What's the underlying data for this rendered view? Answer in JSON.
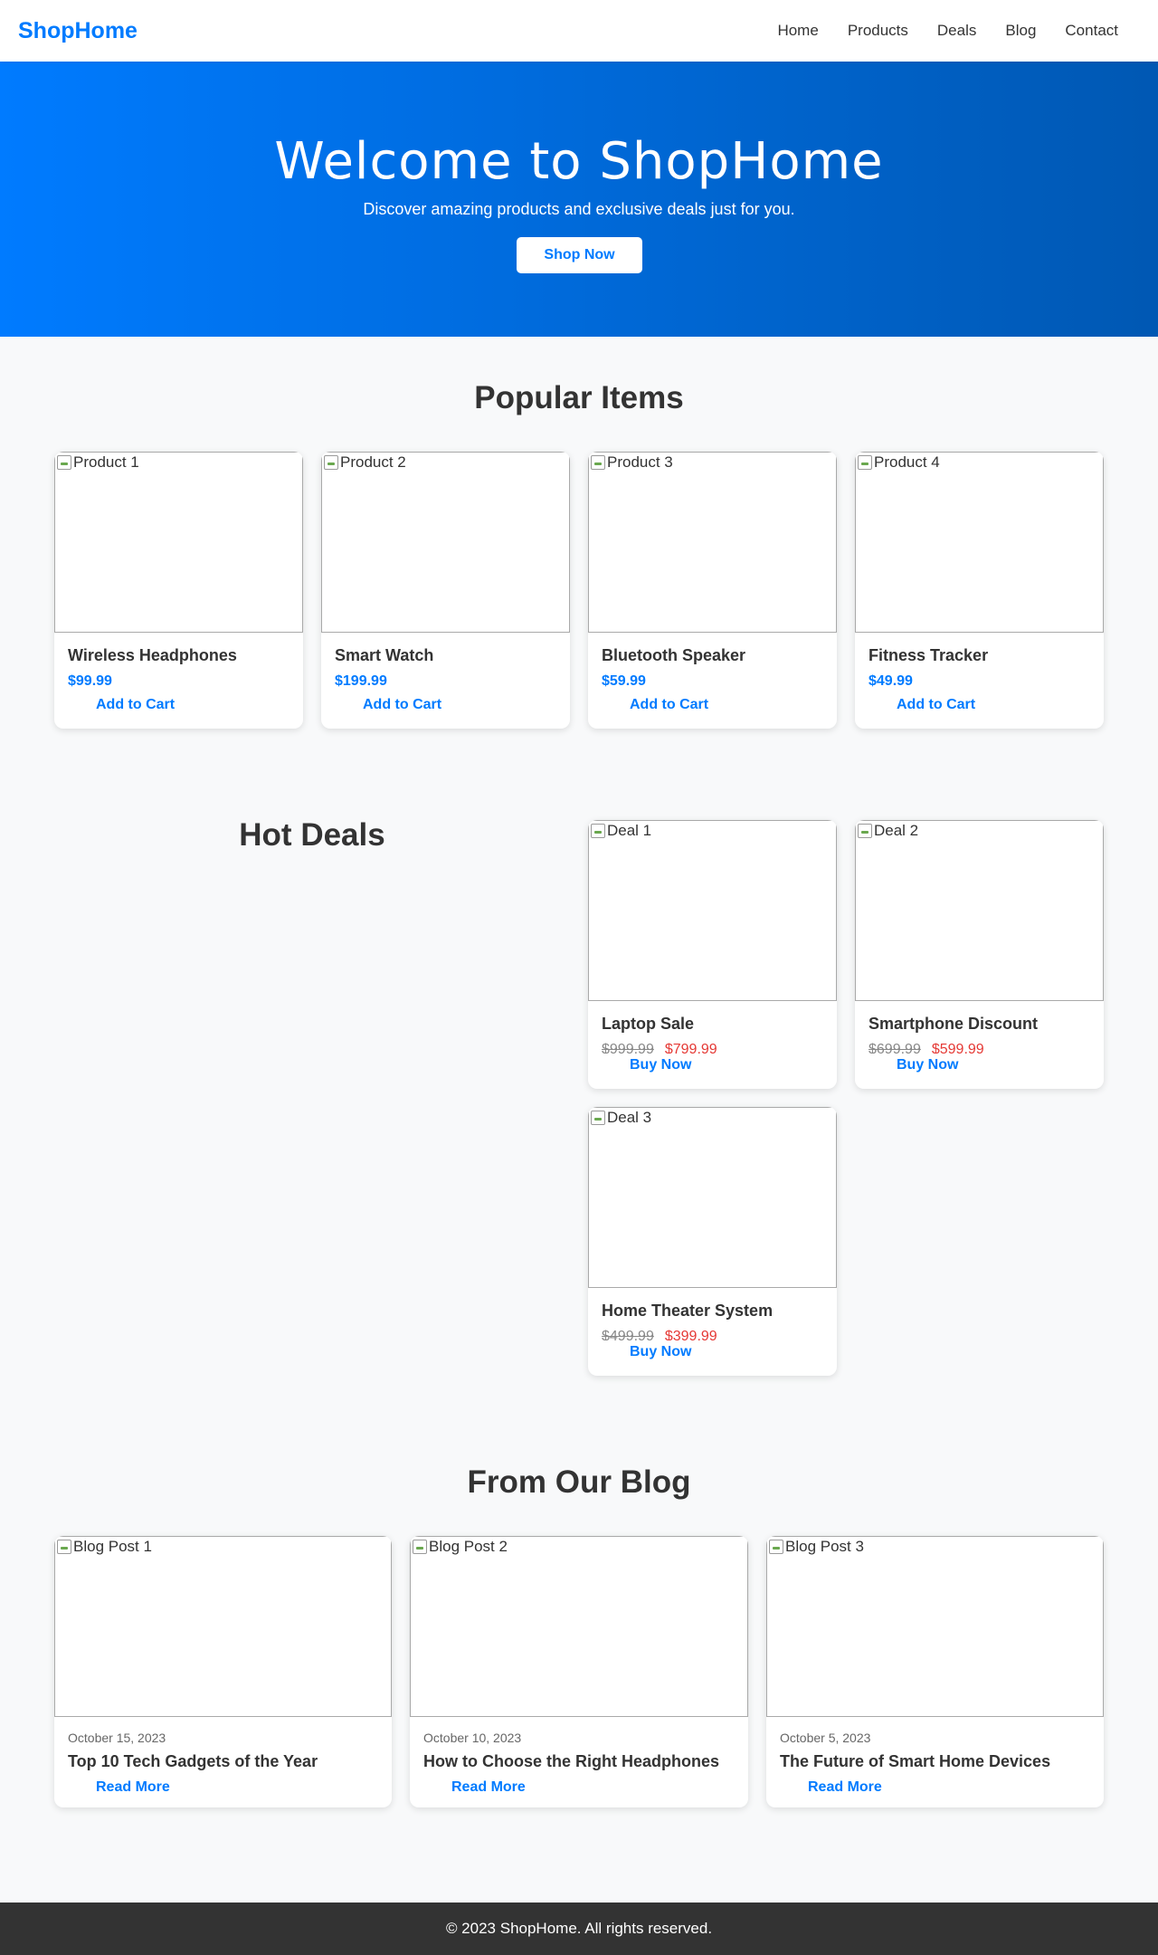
{
  "header": {
    "logo": "ShopHome",
    "nav": [
      "Home",
      "Products",
      "Deals",
      "Blog",
      "Contact"
    ]
  },
  "hero": {
    "title": "Welcome to ShopHome",
    "subtitle": "Discover amazing products and exclusive deals just for you.",
    "cta": "Shop Now"
  },
  "popular": {
    "title": "Popular Items",
    "items": [
      {
        "img_alt": "Product 1",
        "name": "Wireless Headphones",
        "price": "$99.99",
        "button": "Add to Cart"
      },
      {
        "img_alt": "Product 2",
        "name": "Smart Watch",
        "price": "$199.99",
        "button": "Add to Cart"
      },
      {
        "img_alt": "Product 3",
        "name": "Bluetooth Speaker",
        "price": "$59.99",
        "button": "Add to Cart"
      },
      {
        "img_alt": "Product 4",
        "name": "Fitness Tracker",
        "price": "$49.99",
        "button": "Add to Cart"
      }
    ]
  },
  "deals": {
    "title": "Hot Deals",
    "items": [
      {
        "img_alt": "Deal 1",
        "name": "Laptop Sale",
        "old_price": "$999.99",
        "new_price": "$799.99",
        "button": "Buy Now"
      },
      {
        "img_alt": "Deal 2",
        "name": "Smartphone Discount",
        "old_price": "$699.99",
        "new_price": "$599.99",
        "button": "Buy Now"
      },
      {
        "img_alt": "Deal 3",
        "name": "Home Theater System",
        "old_price": "$499.99",
        "new_price": "$399.99",
        "button": "Buy Now"
      }
    ]
  },
  "blog": {
    "title": "From Our Blog",
    "posts": [
      {
        "img_alt": "Blog Post 1",
        "date": "October 15, 2023",
        "title": "Top 10 Tech Gadgets of the Year",
        "button": "Read More"
      },
      {
        "img_alt": "Blog Post 2",
        "date": "October 10, 2023",
        "title": "How to Choose the Right Headphones",
        "button": "Read More"
      },
      {
        "img_alt": "Blog Post 3",
        "date": "October 5, 2023",
        "title": "The Future of Smart Home Devices",
        "button": "Read More"
      }
    ]
  },
  "footer": {
    "text": "© 2023 ShopHome. All rights reserved."
  },
  "colors": {
    "accent": "#007bff",
    "hero_gradient_start": "#007bff",
    "hero_gradient_end": "#0058b3",
    "sale_price": "#e53935",
    "footer_bg": "#333333",
    "page_bg": "#f8f9fa"
  }
}
